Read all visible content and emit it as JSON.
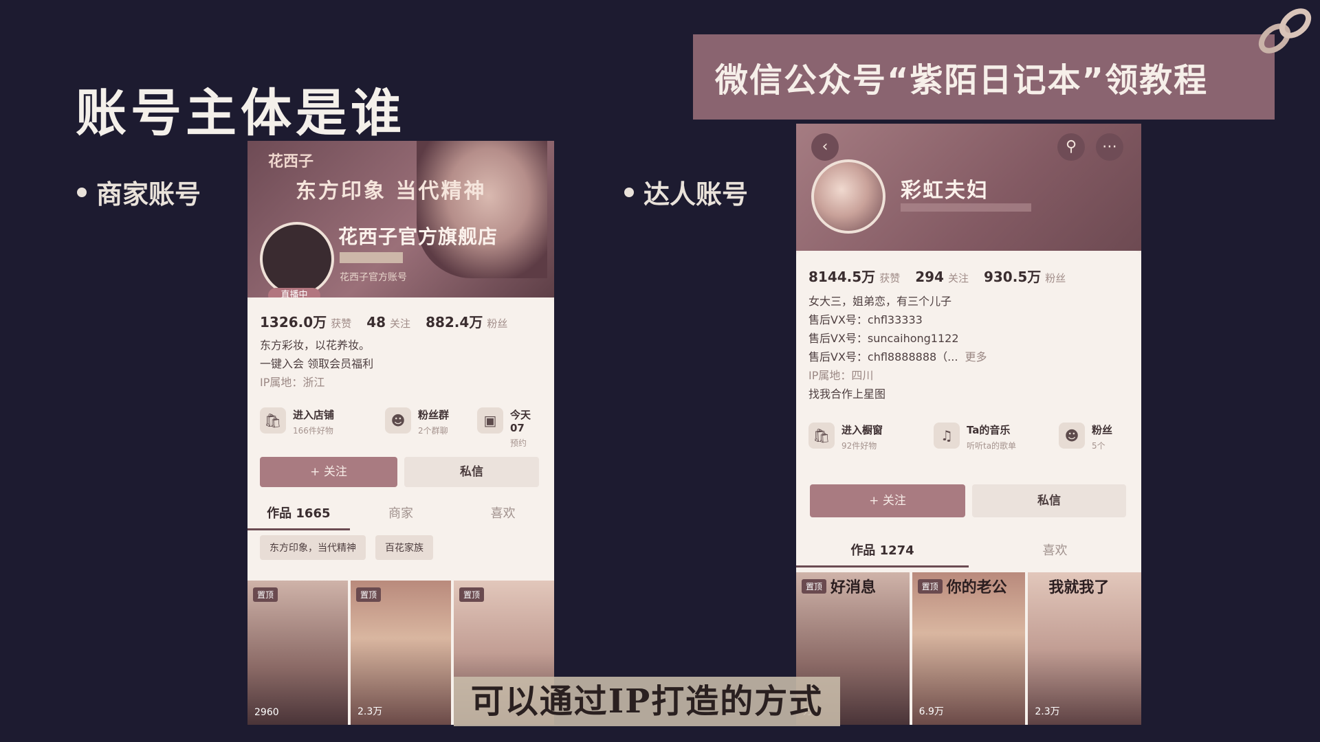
{
  "slide": {
    "title": "账号主体是谁",
    "bullet_merchant": "商家账号",
    "bullet_creator": "达人账号",
    "banner": "微信公众号“紫陌日记本”领教程",
    "subtitle": "可以通过IP打造的方式"
  },
  "merchant": {
    "header_brand": "花西子",
    "header_slogan": "东方印象 当代精神",
    "name": "花西子官方旗舰店",
    "live_tag": "直播中",
    "verified": "花西子官方账号",
    "stats": [
      {
        "num": "1326.0万",
        "label": "获赞"
      },
      {
        "num": "48",
        "label": "关注"
      },
      {
        "num": "882.4万",
        "label": "粉丝"
      }
    ],
    "bio_line1": "东方彩妆，以花养妆。",
    "bio_line2": "一键入会 领取会员福利",
    "bio_line3": "IP属地：浙江",
    "features": [
      {
        "icon": "bag-icon",
        "title": "进入店铺",
        "sub": "166件好物"
      },
      {
        "icon": "fans-group-icon",
        "title": "粉丝群",
        "sub": "2个群聊"
      },
      {
        "icon": "calendar-icon",
        "title": "今天07",
        "sub": "预约"
      }
    ],
    "follow": "+ 关注",
    "dm": "私信",
    "tabs": [
      "作品 1665",
      "商家",
      "喜欢"
    ],
    "collections": [
      "东方印象，当代精神",
      "百花家族"
    ],
    "thumbs": [
      {
        "tag": "置顶",
        "likes": "2960"
      },
      {
        "tag": "置顶",
        "likes": "2.3万"
      },
      {
        "tag": "置顶",
        "likes": ""
      }
    ]
  },
  "creator": {
    "name": "彩虹夫妇",
    "stats": [
      {
        "num": "8144.5万",
        "label": "获赞"
      },
      {
        "num": "294",
        "label": "关注"
      },
      {
        "num": "930.5万",
        "label": "粉丝"
      }
    ],
    "bio_line1": "女大三，姐弟恋，有三个儿子",
    "bio_line2": "售后VX号：chfl33333",
    "bio_line3": "售后VX号：suncaihong1122",
    "bio_line4": "售后VX号：chfl8888888（...",
    "more": "更多",
    "bio_line5": "IP属地：四川",
    "bio_line6": "找我合作上星图",
    "features": [
      {
        "icon": "bag-icon",
        "title": "进入橱窗",
        "sub": "92件好物"
      },
      {
        "icon": "music-icon",
        "title": "Ta的音乐",
        "sub": "听听ta的歌单"
      },
      {
        "icon": "fans-group-icon",
        "title": "粉丝",
        "sub": "5个"
      }
    ],
    "follow": "+ 关注",
    "dm": "私信",
    "tabs": [
      "作品 1274",
      "喜欢"
    ],
    "thumbs": [
      {
        "tag": "置顶",
        "caption": "好消息",
        "likes": "万"
      },
      {
        "tag": "置顶",
        "caption": "你的老公",
        "likes": "6.9万"
      },
      {
        "tag": "",
        "caption": "我就我了",
        "likes": "2.3万"
      }
    ]
  }
}
